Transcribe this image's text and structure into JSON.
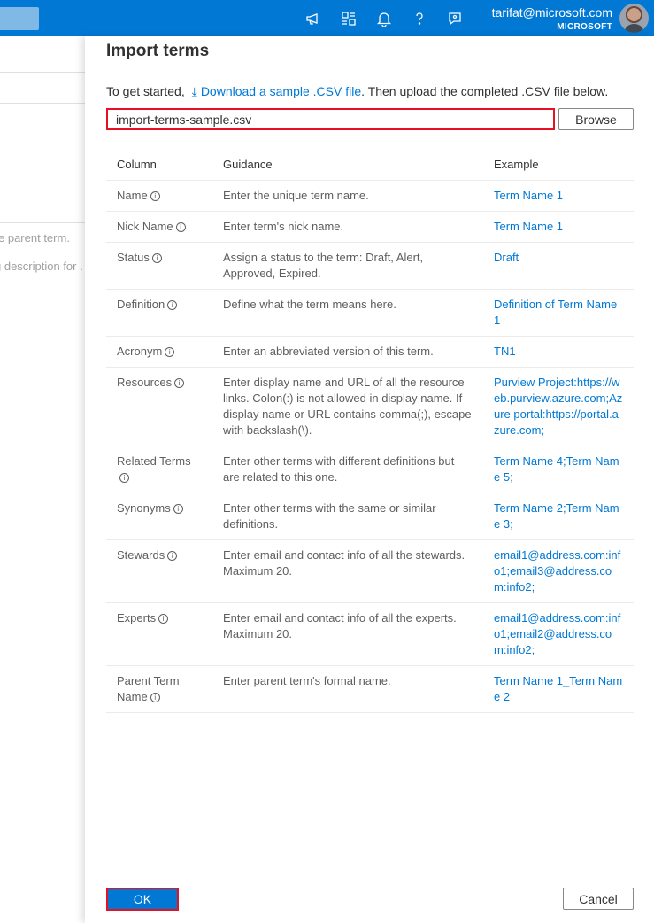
{
  "header": {
    "account_email": "tarifat@microsoft.com",
    "account_tenant": "MICROSOFT",
    "icons": [
      "megaphone-icon",
      "directory-switch-icon",
      "bell-icon",
      "help-icon",
      "feedback-icon"
    ]
  },
  "background": {
    "text1": "e parent term.",
    "text2": "g description for ."
  },
  "panel": {
    "title": "Import terms",
    "intro_prefix": "To get started,",
    "download_link": "Download a sample .CSV file",
    "intro_suffix": ". Then upload the completed .CSV file below.",
    "file_name": "import-terms-sample.csv",
    "browse_label": "Browse",
    "columns": [
      "Column",
      "Guidance",
      "Example"
    ],
    "rows": [
      {
        "name": "Name",
        "guidance": "Enter the unique term name.",
        "example": "Term Name 1"
      },
      {
        "name": "Nick Name",
        "guidance": "Enter term's nick name.",
        "example": "Term Name 1"
      },
      {
        "name": "Status",
        "guidance": "Assign a status to the term: Draft, Alert, Approved, Expired.",
        "example": "Draft"
      },
      {
        "name": "Definition",
        "guidance": "Define what the term means here.",
        "example": "Definition of Term Name 1"
      },
      {
        "name": "Acronym",
        "guidance": "Enter an abbreviated version of this term.",
        "example": "TN1"
      },
      {
        "name": "Resources",
        "guidance": "Enter display name and URL of all the resource links. Colon(:) is not allowed in display name. If display name or URL contains comma(;), escape with backslash(\\).",
        "example": "Purview Project:https://web.purview.azure.com;Azure portal:https://portal.azure.com;"
      },
      {
        "name": "Related Terms",
        "guidance": "Enter other terms with different definitions but are related to this one.",
        "example": "Term Name 4;Term Name 5;"
      },
      {
        "name": "Synonyms",
        "guidance": "Enter other terms with the same or similar definitions.",
        "example": "Term Name 2;Term Name 3;"
      },
      {
        "name": "Stewards",
        "guidance": "Enter email and contact info of all the stewards. Maximum 20.",
        "example": "email1@address.com:info1;email3@address.com:info2;"
      },
      {
        "name": "Experts",
        "guidance": "Enter email and contact info of all the experts. Maximum 20.",
        "example": "email1@address.com:info1;email2@address.com:info2;"
      },
      {
        "name": "Parent Term Name",
        "guidance": "Enter parent term's formal name.",
        "example": "Term Name 1_Term Name 2"
      }
    ],
    "ok_label": "OK",
    "cancel_label": "Cancel"
  }
}
